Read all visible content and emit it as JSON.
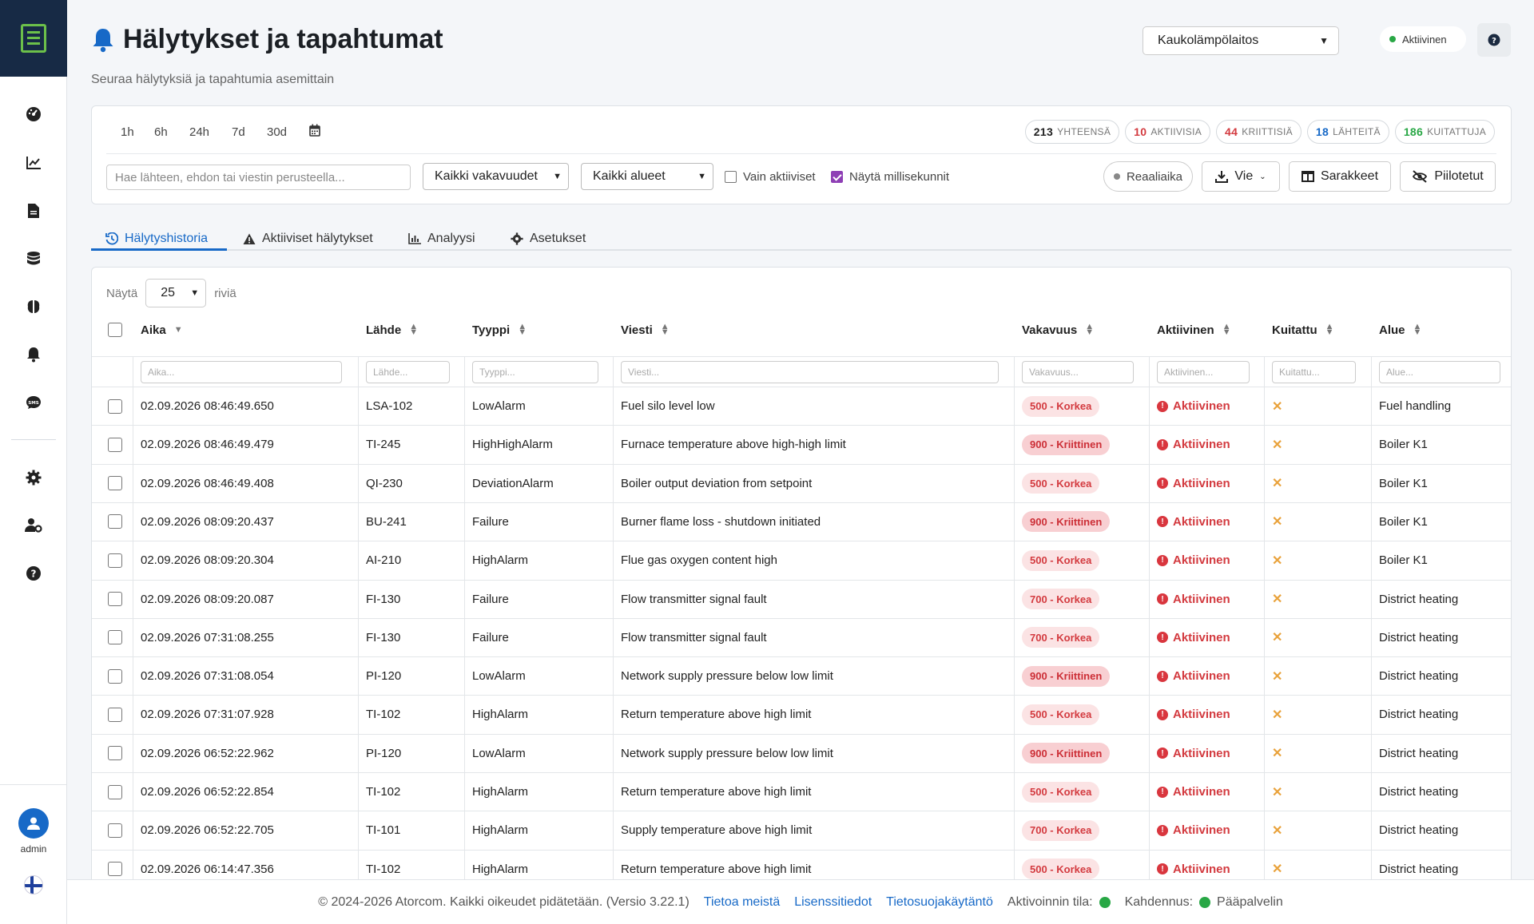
{
  "page": {
    "title": "Hälytykset ja tapahtumat",
    "subtitle": "Seuraa hälytyksiä ja tapahtumia asemittain",
    "site_selected": "Kaukolämpölaitos",
    "status_label": "Aktiivinen"
  },
  "sidebar": {
    "user_label": "admin",
    "icons": [
      "dashboard-icon",
      "chart-line-icon",
      "document-icon",
      "database-icon",
      "brain-icon",
      "bell-icon",
      "sms-icon",
      "settings-icon",
      "user-cog-icon",
      "help-icon"
    ]
  },
  "filters": {
    "time_ranges": [
      "1h",
      "6h",
      "24h",
      "7d",
      "30d"
    ],
    "search_placeholder": "Hae lähteen, ehdon tai viestin perusteella...",
    "severity_selected": "Kaikki vakavuudet",
    "area_selected": "Kaikki alueet",
    "only_active_label": "Vain aktiiviset",
    "only_active_checked": false,
    "show_ms_label": "Näytä millisekunnit",
    "show_ms_checked": true,
    "realtime_label": "Reaaliaika",
    "export_label": "Vie",
    "columns_label": "Sarakkeet",
    "hidden_label": "Piilotetut"
  },
  "stats": [
    {
      "value": "213",
      "label": "YHTEENSÄ",
      "color": "#222222"
    },
    {
      "value": "10",
      "label": "AKTIIVISIA",
      "color": "#d33a3f"
    },
    {
      "value": "44",
      "label": "KRIITTISIÄ",
      "color": "#d33a3f"
    },
    {
      "value": "18",
      "label": "LÄHTEITÄ",
      "color": "#1769c7"
    },
    {
      "value": "186",
      "label": "KUITATTUJA",
      "color": "#28a745"
    }
  ],
  "tabs": [
    {
      "label": "Hälytyshistoria",
      "icon": "history-icon",
      "active": true
    },
    {
      "label": "Aktiiviset hälytykset",
      "icon": "warning-icon",
      "active": false
    },
    {
      "label": "Analyysi",
      "icon": "bar-chart-icon",
      "active": false
    },
    {
      "label": "Asetukset",
      "icon": "gear-icon",
      "active": false
    }
  ],
  "table": {
    "show_label": "Näytä",
    "rows_label": "riviä",
    "page_size": "25",
    "columns": [
      "Aika",
      "Lähde",
      "Tyyppi",
      "Viesti",
      "Vakavuus",
      "Aktiivinen",
      "Kuitattu",
      "Alue"
    ],
    "filter_placeholders": [
      "Aika...",
      "Lähde...",
      "Tyyppi...",
      "Viesti...",
      "Vakavuus...",
      "Aktiivinen...",
      "Kuitattu...",
      "Alue..."
    ],
    "rows": [
      {
        "time": "02.09.2026 08:46:49.650",
        "source": "LSA-102",
        "type": "LowAlarm",
        "message": "Fuel silo level low",
        "severity": "500 - Korkea",
        "sev_level": "high",
        "active": "Aktiivinen",
        "ack": "✕",
        "area": "Fuel handling"
      },
      {
        "time": "02.09.2026 08:46:49.479",
        "source": "TI-245",
        "type": "HighHighAlarm",
        "message": "Furnace temperature above high-high limit",
        "severity": "900 - Kriittinen",
        "sev_level": "crit",
        "active": "Aktiivinen",
        "ack": "✕",
        "area": "Boiler K1"
      },
      {
        "time": "02.09.2026 08:46:49.408",
        "source": "QI-230",
        "type": "DeviationAlarm",
        "message": "Boiler output deviation from setpoint",
        "severity": "500 - Korkea",
        "sev_level": "high",
        "active": "Aktiivinen",
        "ack": "✕",
        "area": "Boiler K1"
      },
      {
        "time": "02.09.2026 08:09:20.437",
        "source": "BU-241",
        "type": "Failure",
        "message": "Burner flame loss - shutdown initiated",
        "severity": "900 - Kriittinen",
        "sev_level": "crit",
        "active": "Aktiivinen",
        "ack": "✕",
        "area": "Boiler K1"
      },
      {
        "time": "02.09.2026 08:09:20.304",
        "source": "AI-210",
        "type": "HighAlarm",
        "message": "Flue gas oxygen content high",
        "severity": "500 - Korkea",
        "sev_level": "high",
        "active": "Aktiivinen",
        "ack": "✕",
        "area": "Boiler K1"
      },
      {
        "time": "02.09.2026 08:09:20.087",
        "source": "FI-130",
        "type": "Failure",
        "message": "Flow transmitter signal fault",
        "severity": "700 - Korkea",
        "sev_level": "high",
        "active": "Aktiivinen",
        "ack": "✕",
        "area": "District heating"
      },
      {
        "time": "02.09.2026 07:31:08.255",
        "source": "FI-130",
        "type": "Failure",
        "message": "Flow transmitter signal fault",
        "severity": "700 - Korkea",
        "sev_level": "high",
        "active": "Aktiivinen",
        "ack": "✕",
        "area": "District heating"
      },
      {
        "time": "02.09.2026 07:31:08.054",
        "source": "PI-120",
        "type": "LowAlarm",
        "message": "Network supply pressure below low limit",
        "severity": "900 - Kriittinen",
        "sev_level": "crit",
        "active": "Aktiivinen",
        "ack": "✕",
        "area": "District heating"
      },
      {
        "time": "02.09.2026 07:31:07.928",
        "source": "TI-102",
        "type": "HighAlarm",
        "message": "Return temperature above high limit",
        "severity": "500 - Korkea",
        "sev_level": "high",
        "active": "Aktiivinen",
        "ack": "✕",
        "area": "District heating"
      },
      {
        "time": "02.09.2026 06:52:22.962",
        "source": "PI-120",
        "type": "LowAlarm",
        "message": "Network supply pressure below low limit",
        "severity": "900 - Kriittinen",
        "sev_level": "crit",
        "active": "Aktiivinen",
        "ack": "✕",
        "area": "District heating"
      },
      {
        "time": "02.09.2026 06:52:22.854",
        "source": "TI-102",
        "type": "HighAlarm",
        "message": "Return temperature above high limit",
        "severity": "500 - Korkea",
        "sev_level": "high",
        "active": "Aktiivinen",
        "ack": "✕",
        "area": "District heating"
      },
      {
        "time": "02.09.2026 06:52:22.705",
        "source": "TI-101",
        "type": "HighAlarm",
        "message": "Supply temperature above high limit",
        "severity": "700 - Korkea",
        "sev_level": "high",
        "active": "Aktiivinen",
        "ack": "✕",
        "area": "District heating"
      },
      {
        "time": "02.09.2026 06:14:47.356",
        "source": "TI-102",
        "type": "HighAlarm",
        "message": "Return temperature above high limit",
        "severity": "500 - Korkea",
        "sev_level": "high",
        "active": "Aktiivinen",
        "ack": "✕",
        "area": "District heating"
      }
    ]
  },
  "footer": {
    "copyright": "© 2024-2026 Atorcom. Kaikki oikeudet pidätetään. (Versio 3.22.1)",
    "link_about": "Tietoa meistä",
    "link_license": "Lisenssitiedot",
    "link_privacy": "Tietosuojakäytäntö",
    "activation_label": "Aktivoinnin tila:",
    "redundancy_label": "Kahdennus:",
    "redundancy_value": "Pääpalvelin"
  }
}
